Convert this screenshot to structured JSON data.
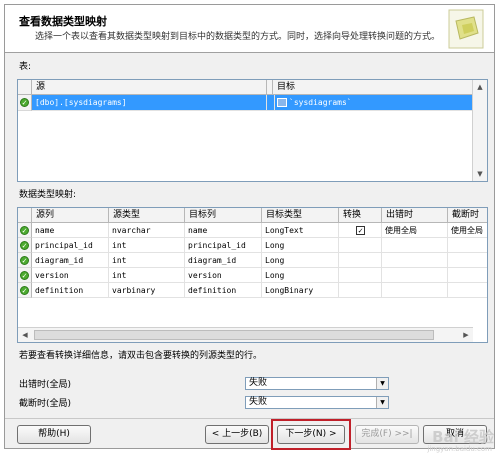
{
  "header": {
    "title": "查看数据类型映射",
    "description": "选择一个表以查看其数据类型映射到目标中的数据类型的方式。同时，选择向导处理转换问题的方式。"
  },
  "tables_section": {
    "label": "表:",
    "columns": [
      "源",
      "目标"
    ],
    "rows": [
      {
        "source": "[dbo].[sysdiagrams]",
        "target": "`sysdiagrams`"
      }
    ]
  },
  "mapping_section": {
    "label": "数据类型映射:",
    "columns": [
      "源列",
      "源类型",
      "目标列",
      "目标类型",
      "转换",
      "出错时",
      "截断时"
    ],
    "rows": [
      {
        "source_col": "name",
        "source_type": "nvarchar",
        "target_col": "name",
        "target_type": "LongText",
        "convert": "✓",
        "on_error": "使用全局",
        "on_truncate": "使用全局"
      },
      {
        "source_col": "principal_id",
        "source_type": "int",
        "target_col": "principal_id",
        "target_type": "Long",
        "convert": "",
        "on_error": "",
        "on_truncate": ""
      },
      {
        "source_col": "diagram_id",
        "source_type": "int",
        "target_col": "diagram_id",
        "target_type": "Long",
        "convert": "",
        "on_error": "",
        "on_truncate": ""
      },
      {
        "source_col": "version",
        "source_type": "int",
        "target_col": "version",
        "target_type": "Long",
        "convert": "",
        "on_error": "",
        "on_truncate": ""
      },
      {
        "source_col": "definition",
        "source_type": "varbinary",
        "target_col": "definition",
        "target_type": "LongBinary",
        "convert": "",
        "on_error": "",
        "on_truncate": ""
      }
    ],
    "hint": "若要查看转换详细信息，请双击包含要转换的列源类型的行。"
  },
  "global_settings": {
    "on_error_label": "出错时(全局)",
    "on_error_value": "失败",
    "on_truncate_label": "截断时(全局)",
    "on_truncate_value": "失败"
  },
  "buttons": {
    "help": "帮助(H)",
    "back": "< 上一步(B)",
    "next": "下一步(N) >",
    "finish": "完成(F) >>|",
    "cancel": "取消"
  },
  "watermark": {
    "text": "Bai 经验",
    "sub": "jingyan.baidu.com"
  },
  "icons": {
    "ok": "ok-status-icon",
    "table": "table-icon",
    "logo": "wizard-logo-icon"
  },
  "colors": {
    "selection": "#3399ff",
    "highlight_border": "#c0202a"
  }
}
